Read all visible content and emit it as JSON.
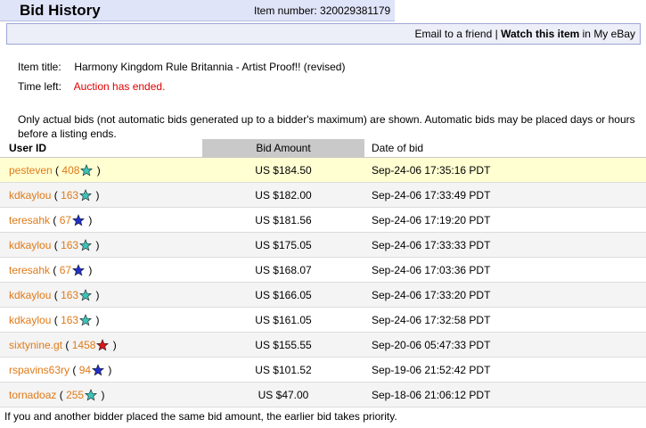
{
  "header": {
    "title": "Bid History",
    "item_number": "Item number: 320029381179"
  },
  "actions": {
    "email": "Email to a friend",
    "separator": "|",
    "watch": "Watch this item",
    "suffix": "in My eBay"
  },
  "item": {
    "title_label": "Item title:",
    "title_value": "Harmony Kingdom Rule Britannia - Artist Proof!! (revised)",
    "time_label": "Time left:",
    "time_value": "Auction has ended."
  },
  "note": "Only actual bids (not automatic bids generated up to a bidder's maximum) are shown. Automatic bids may be placed days or hours before a listing ends.",
  "table": {
    "headers": [
      "User ID",
      "Bid Amount",
      "Date of bid"
    ],
    "rows": [
      {
        "user": "pesteven",
        "score": "408",
        "star": "turquoise-star-icon",
        "amount": "US $184.50",
        "date": "Sep-24-06 17:35:16 PDT"
      },
      {
        "user": "kdkaylou",
        "score": "163",
        "star": "turquoise-star-icon",
        "amount": "US $182.00",
        "date": "Sep-24-06 17:33:49 PDT"
      },
      {
        "user": "teresahk",
        "score": "67",
        "star": "blue-star-icon",
        "amount": "US $181.56",
        "date": "Sep-24-06 17:19:20 PDT"
      },
      {
        "user": "kdkaylou",
        "score": "163",
        "star": "turquoise-star-icon",
        "amount": "US $175.05",
        "date": "Sep-24-06 17:33:33 PDT"
      },
      {
        "user": "teresahk",
        "score": "67",
        "star": "blue-star-icon",
        "amount": "US $168.07",
        "date": "Sep-24-06 17:03:36 PDT"
      },
      {
        "user": "kdkaylou",
        "score": "163",
        "star": "turquoise-star-icon",
        "amount": "US $166.05",
        "date": "Sep-24-06 17:33:20 PDT"
      },
      {
        "user": "kdkaylou",
        "score": "163",
        "star": "turquoise-star-icon",
        "amount": "US $161.05",
        "date": "Sep-24-06 17:32:58 PDT"
      },
      {
        "user": "sixtynine.gt",
        "score": "1458",
        "star": "red-star-icon",
        "amount": "US $155.55",
        "date": "Sep-20-06 05:47:33 PDT"
      },
      {
        "user": "rspavins63ry",
        "score": "94",
        "star": "blue-star-icon",
        "amount": "US $101.52",
        "date": "Sep-19-06 21:52:42 PDT"
      },
      {
        "user": "tornadoaz",
        "score": "255",
        "star": "turquoise-star-icon",
        "amount": "US $47.00",
        "date": "Sep-18-06 21:06:12 PDT"
      }
    ]
  },
  "colors": {
    "turquoise": "#3cc4b8",
    "blue": "#2030c8",
    "red": "#d81818"
  },
  "footer": "If you and another bidder placed the same bid amount, the earlier bid takes priority."
}
